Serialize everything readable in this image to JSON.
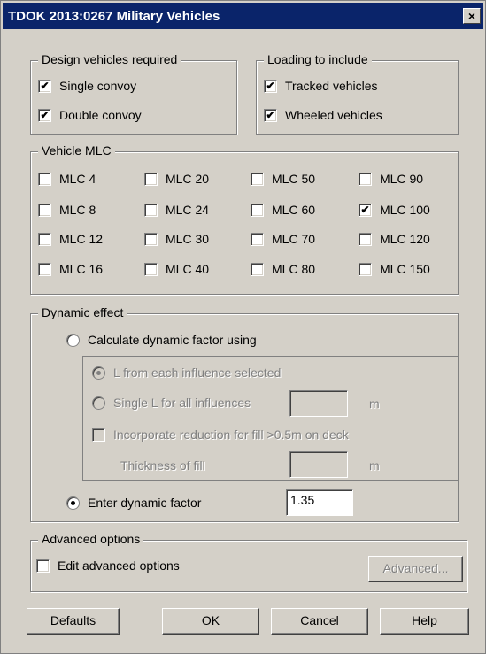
{
  "window": {
    "title": "TDOK 2013:0267 Military Vehicles",
    "close_label": "×"
  },
  "design_vehicles": {
    "title": "Design vehicles required",
    "items": [
      {
        "label": "Single convoy",
        "checked": true
      },
      {
        "label": "Double convoy",
        "checked": true
      }
    ]
  },
  "loading": {
    "title": "Loading to include",
    "items": [
      {
        "label": "Tracked vehicles",
        "checked": true
      },
      {
        "label": "Wheeled vehicles",
        "checked": true
      }
    ]
  },
  "mlc": {
    "title": "Vehicle MLC",
    "items": [
      {
        "label": "MLC 4",
        "checked": false
      },
      {
        "label": "MLC 20",
        "checked": false
      },
      {
        "label": "MLC 50",
        "checked": false
      },
      {
        "label": "MLC 90",
        "checked": false
      },
      {
        "label": "MLC 8",
        "checked": false
      },
      {
        "label": "MLC 24",
        "checked": false
      },
      {
        "label": "MLC 60",
        "checked": false
      },
      {
        "label": "MLC 100",
        "checked": true
      },
      {
        "label": "MLC 12",
        "checked": false
      },
      {
        "label": "MLC 30",
        "checked": false
      },
      {
        "label": "MLC 70",
        "checked": false
      },
      {
        "label": "MLC 120",
        "checked": false
      },
      {
        "label": "MLC 16",
        "checked": false
      },
      {
        "label": "MLC 40",
        "checked": false
      },
      {
        "label": "MLC 80",
        "checked": false
      },
      {
        "label": "MLC 150",
        "checked": false
      }
    ]
  },
  "dynamic": {
    "title": "Dynamic effect",
    "calc_label": "Calculate dynamic factor using",
    "l_each_label": "L from each influence selected",
    "single_l_label": "Single L for all influences",
    "single_l_value": "",
    "unit_m": "m",
    "fill_label": "Incorporate reduction for fill >0.5m on deck",
    "thickness_label": "Thickness of fill",
    "thickness_value": "",
    "enter_label": "Enter dynamic factor",
    "factor_value": "1.35"
  },
  "advanced": {
    "title": "Advanced options",
    "edit_label": "Edit advanced options",
    "button_label": "Advanced..."
  },
  "buttons": {
    "defaults": "Defaults",
    "ok": "OK",
    "cancel": "Cancel",
    "help": "Help"
  },
  "check_mark": "✔"
}
